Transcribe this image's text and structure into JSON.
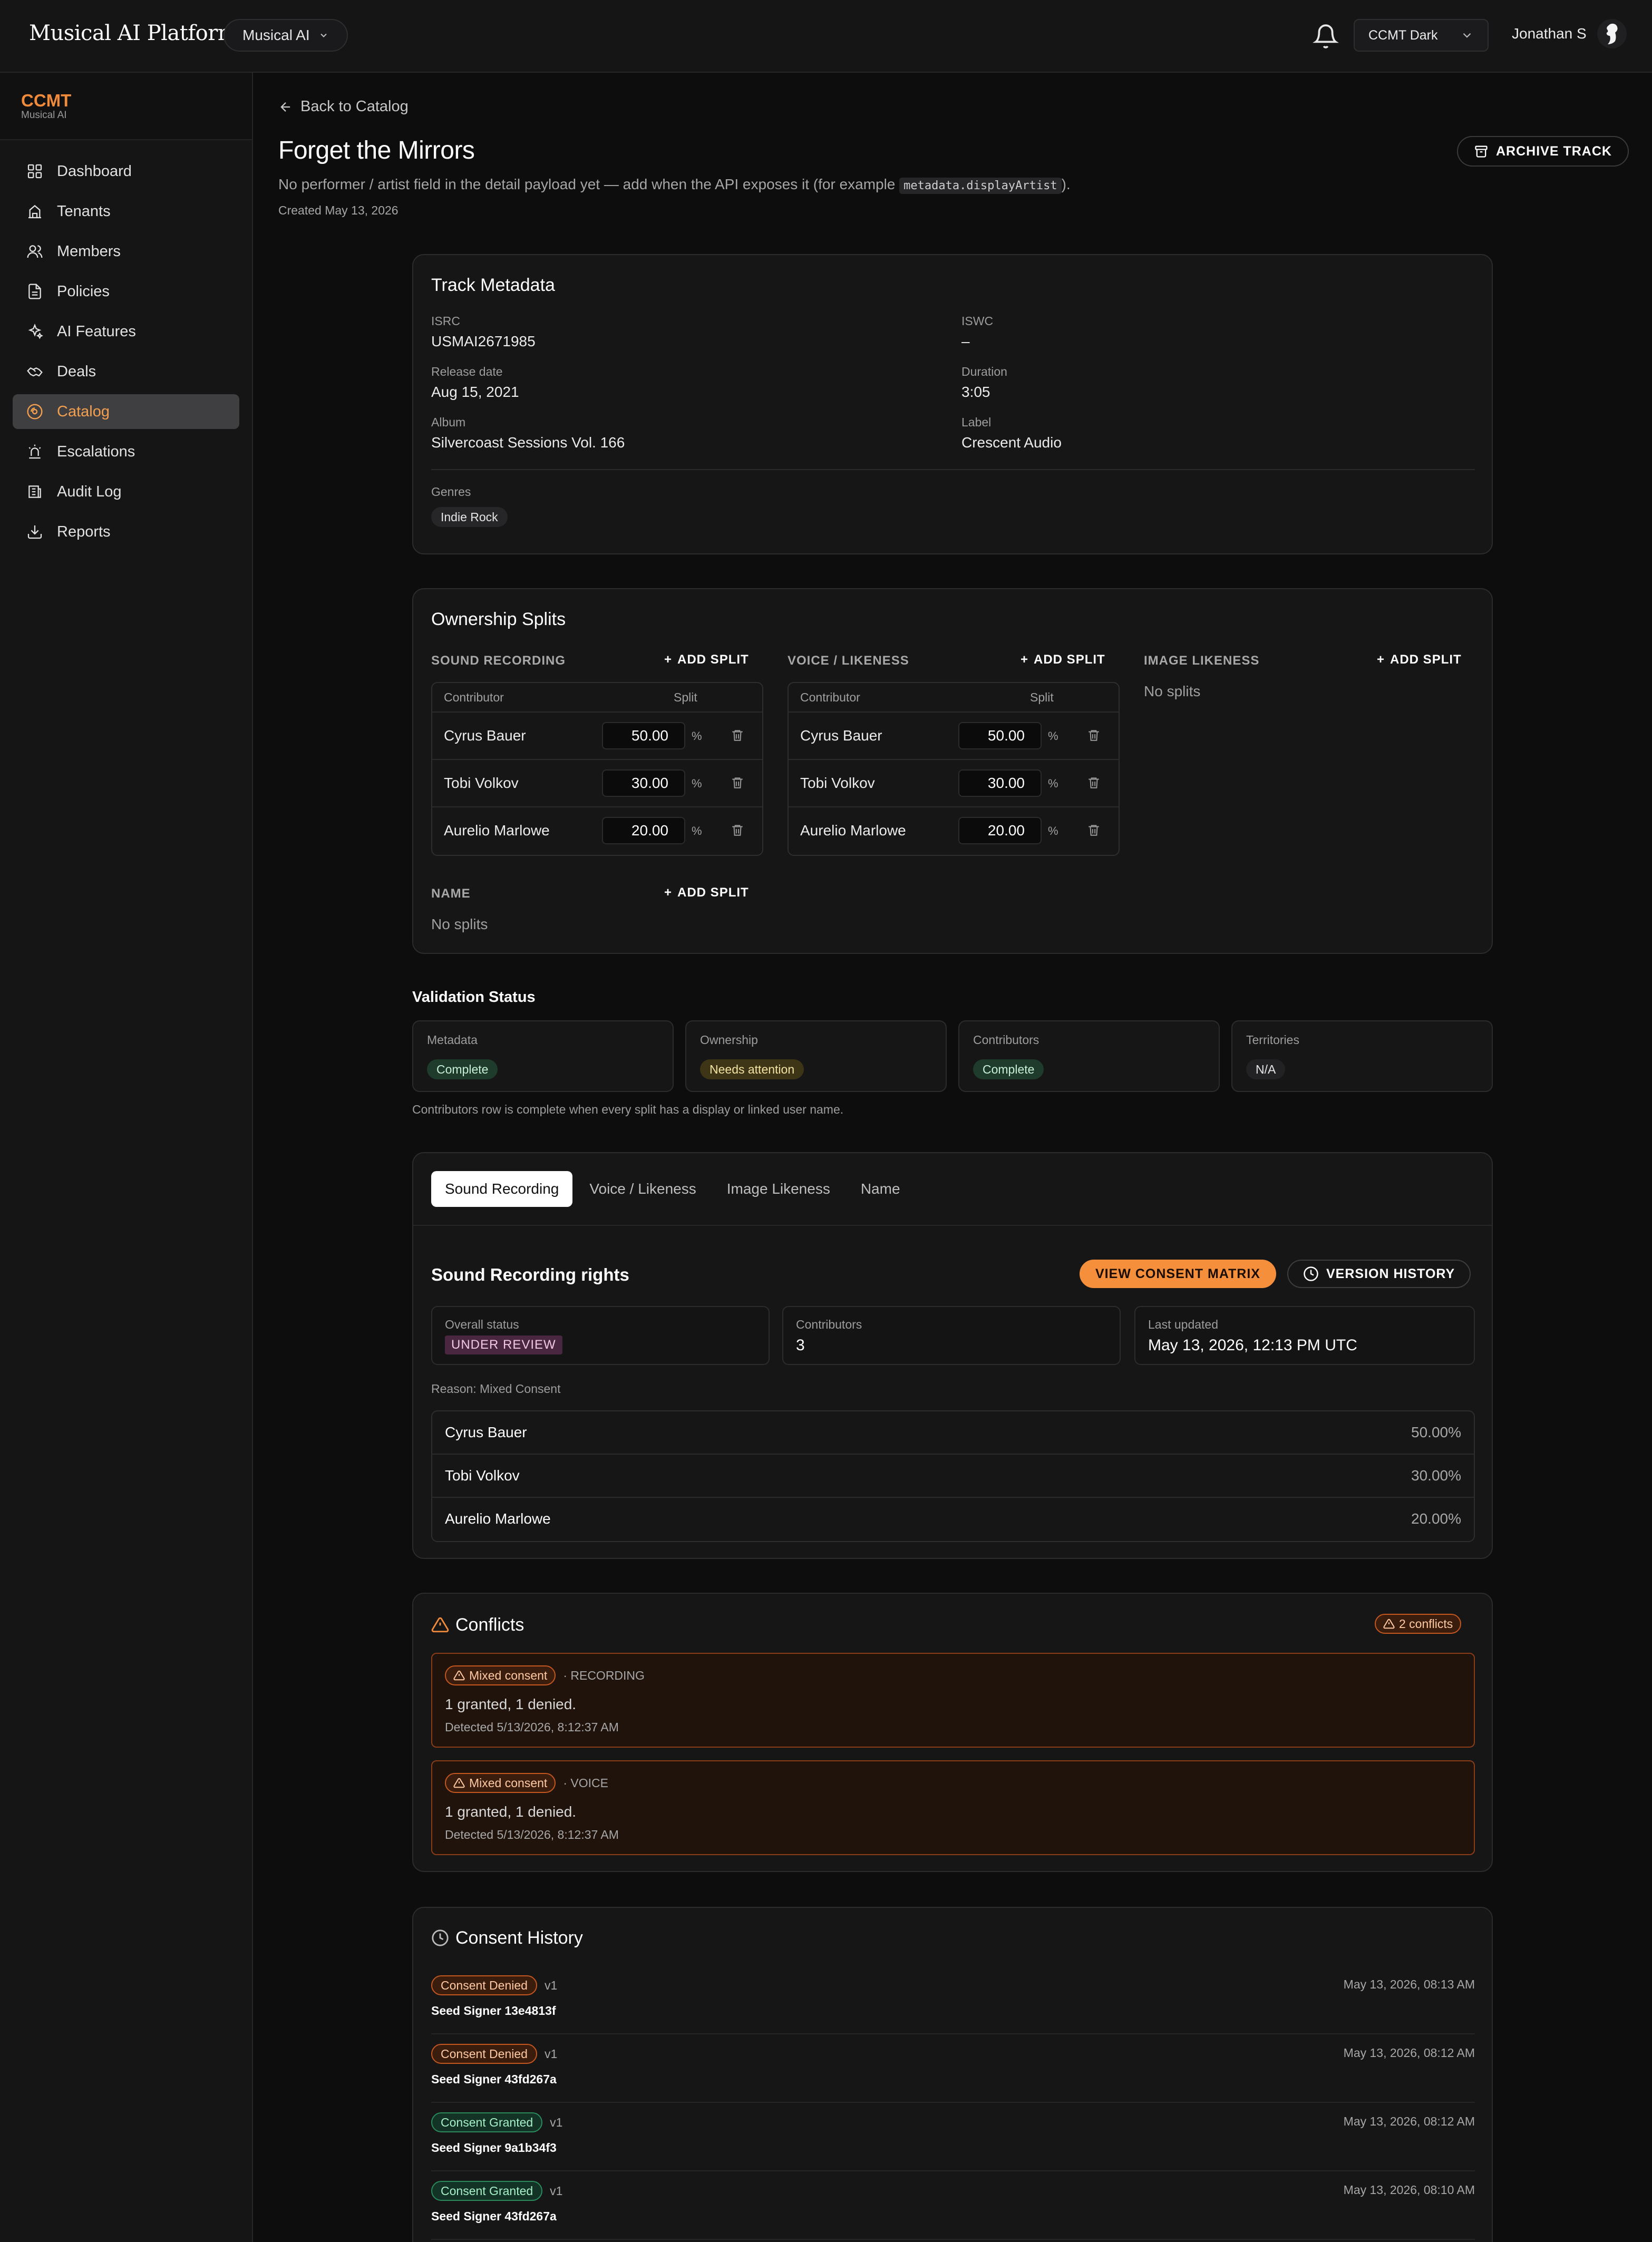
{
  "topbar": {
    "app_title": "Musical AI Platform",
    "org_select": "Musical AI",
    "theme_select": "CCMT Dark",
    "user_name": "Jonathan S"
  },
  "sidebar": {
    "title": "CCMT",
    "subtitle": "Musical AI",
    "items": [
      {
        "label": "Dashboard",
        "icon": "grid-icon"
      },
      {
        "label": "Tenants",
        "icon": "building-icon"
      },
      {
        "label": "Members",
        "icon": "users-icon"
      },
      {
        "label": "Policies",
        "icon": "document-icon"
      },
      {
        "label": "AI Features",
        "icon": "sparkles-icon"
      },
      {
        "label": "Deals",
        "icon": "handshake-icon"
      },
      {
        "label": "Catalog",
        "icon": "disc-icon",
        "active": true
      },
      {
        "label": "Escalations",
        "icon": "siren-icon"
      },
      {
        "label": "Audit Log",
        "icon": "log-icon"
      },
      {
        "label": "Reports",
        "icon": "download-icon"
      }
    ]
  },
  "header": {
    "back": "Back to Catalog",
    "title": "Forget the Mirrors",
    "subtitle_prefix": "No performer / artist field in the detail payload yet — add when the API exposes it (for example",
    "subtitle_code": "metadata.displayArtist",
    "subtitle_suffix": ").",
    "created": "Created May 13, 2026",
    "archive_label": "ARCHIVE TRACK"
  },
  "metadata": {
    "title": "Track Metadata",
    "fields": {
      "isrc_label": "ISRC",
      "isrc": "USMAI2671985",
      "iswc_label": "ISWC",
      "iswc": "–",
      "release_label": "Release date",
      "release": "Aug 15, 2021",
      "duration_label": "Duration",
      "duration": "3:05",
      "album_label": "Album",
      "album": "Silvercoast Sessions Vol. 166",
      "label_label": "Label",
      "label": "Crescent Audio"
    },
    "genres_label": "Genres",
    "genres": [
      "Indie Rock"
    ]
  },
  "splits": {
    "title": "Ownership Splits",
    "add_label": "ADD SPLIT",
    "col_contributor": "Contributor",
    "col_split": "Split",
    "pct": "%",
    "empty": "No splits",
    "sections": [
      {
        "name": "SOUND RECORDING",
        "rows": [
          {
            "name": "Cyrus Bauer",
            "split": "50.00"
          },
          {
            "name": "Tobi Volkov",
            "split": "30.00"
          },
          {
            "name": "Aurelio Marlowe",
            "split": "20.00"
          }
        ]
      },
      {
        "name": "VOICE / LIKENESS",
        "rows": [
          {
            "name": "Cyrus Bauer",
            "split": "50.00"
          },
          {
            "name": "Tobi Volkov",
            "split": "30.00"
          },
          {
            "name": "Aurelio Marlowe",
            "split": "20.00"
          }
        ]
      },
      {
        "name": "IMAGE LIKENESS",
        "rows": []
      },
      {
        "name": "NAME",
        "rows": []
      }
    ]
  },
  "validation": {
    "title": "Validation Status",
    "cards": [
      {
        "label": "Metadata",
        "status": "Complete",
        "color": "#1e3b2c"
      },
      {
        "label": "Ownership",
        "status": "Needs attention",
        "color": "#3d3516"
      },
      {
        "label": "Contributors",
        "status": "Complete",
        "color": "#1e3b2c"
      },
      {
        "label": "Territories",
        "status": "N/A",
        "color": "#222224"
      }
    ],
    "note": "Contributors row is complete when every split has a display or linked user name."
  },
  "rights": {
    "tabs": [
      "Sound Recording",
      "Voice / Likeness",
      "Image Likeness",
      "Name"
    ],
    "active_tab": 0,
    "title": "Sound Recording rights",
    "consent_btn": "VIEW CONSENT MATRIX",
    "history_btn": "VERSION HISTORY",
    "overall_label": "Overall status",
    "overall_value": "UNDER REVIEW",
    "contributors_label": "Contributors",
    "contributors_value": "3",
    "updated_label": "Last updated",
    "updated_value": "May 13, 2026, 12:13 PM UTC",
    "reason": "Reason: Mixed Consent",
    "rows": [
      {
        "name": "Cyrus Bauer",
        "pct": "50.00%"
      },
      {
        "name": "Tobi Volkov",
        "pct": "30.00%"
      },
      {
        "name": "Aurelio Marlowe",
        "pct": "20.00%"
      }
    ]
  },
  "conflicts": {
    "title": "Conflicts",
    "count_badge": "2 conflicts",
    "items": [
      {
        "badge": "Mixed consent",
        "type": "· RECORDING",
        "text": "1 granted, 1 denied.",
        "detected": "Detected 5/13/2026, 8:12:37 AM"
      },
      {
        "badge": "Mixed consent",
        "type": "· VOICE",
        "text": "1 granted, 1 denied.",
        "detected": "Detected 5/13/2026, 8:12:37 AM"
      }
    ]
  },
  "history": {
    "title": "Consent History",
    "items": [
      {
        "status": "Consent Denied",
        "version": "v1",
        "signer": "Seed Signer 13e4813f",
        "time": "May 13, 2026, 08:13 AM",
        "kind": "denied"
      },
      {
        "status": "Consent Denied",
        "version": "v1",
        "signer": "Seed Signer 43fd267a",
        "time": "May 13, 2026, 08:12 AM",
        "kind": "denied"
      },
      {
        "status": "Consent Granted",
        "version": "v1",
        "signer": "Seed Signer 9a1b34f3",
        "time": "May 13, 2026, 08:12 AM",
        "kind": "granted"
      },
      {
        "status": "Consent Granted",
        "version": "v1",
        "signer": "Seed Signer 43fd267a",
        "time": "May 13, 2026, 08:10 AM",
        "kind": "granted"
      }
    ]
  },
  "colors": {
    "accent": "#f08b3c",
    "bg": "#0d0d0e",
    "card": "#161617"
  }
}
